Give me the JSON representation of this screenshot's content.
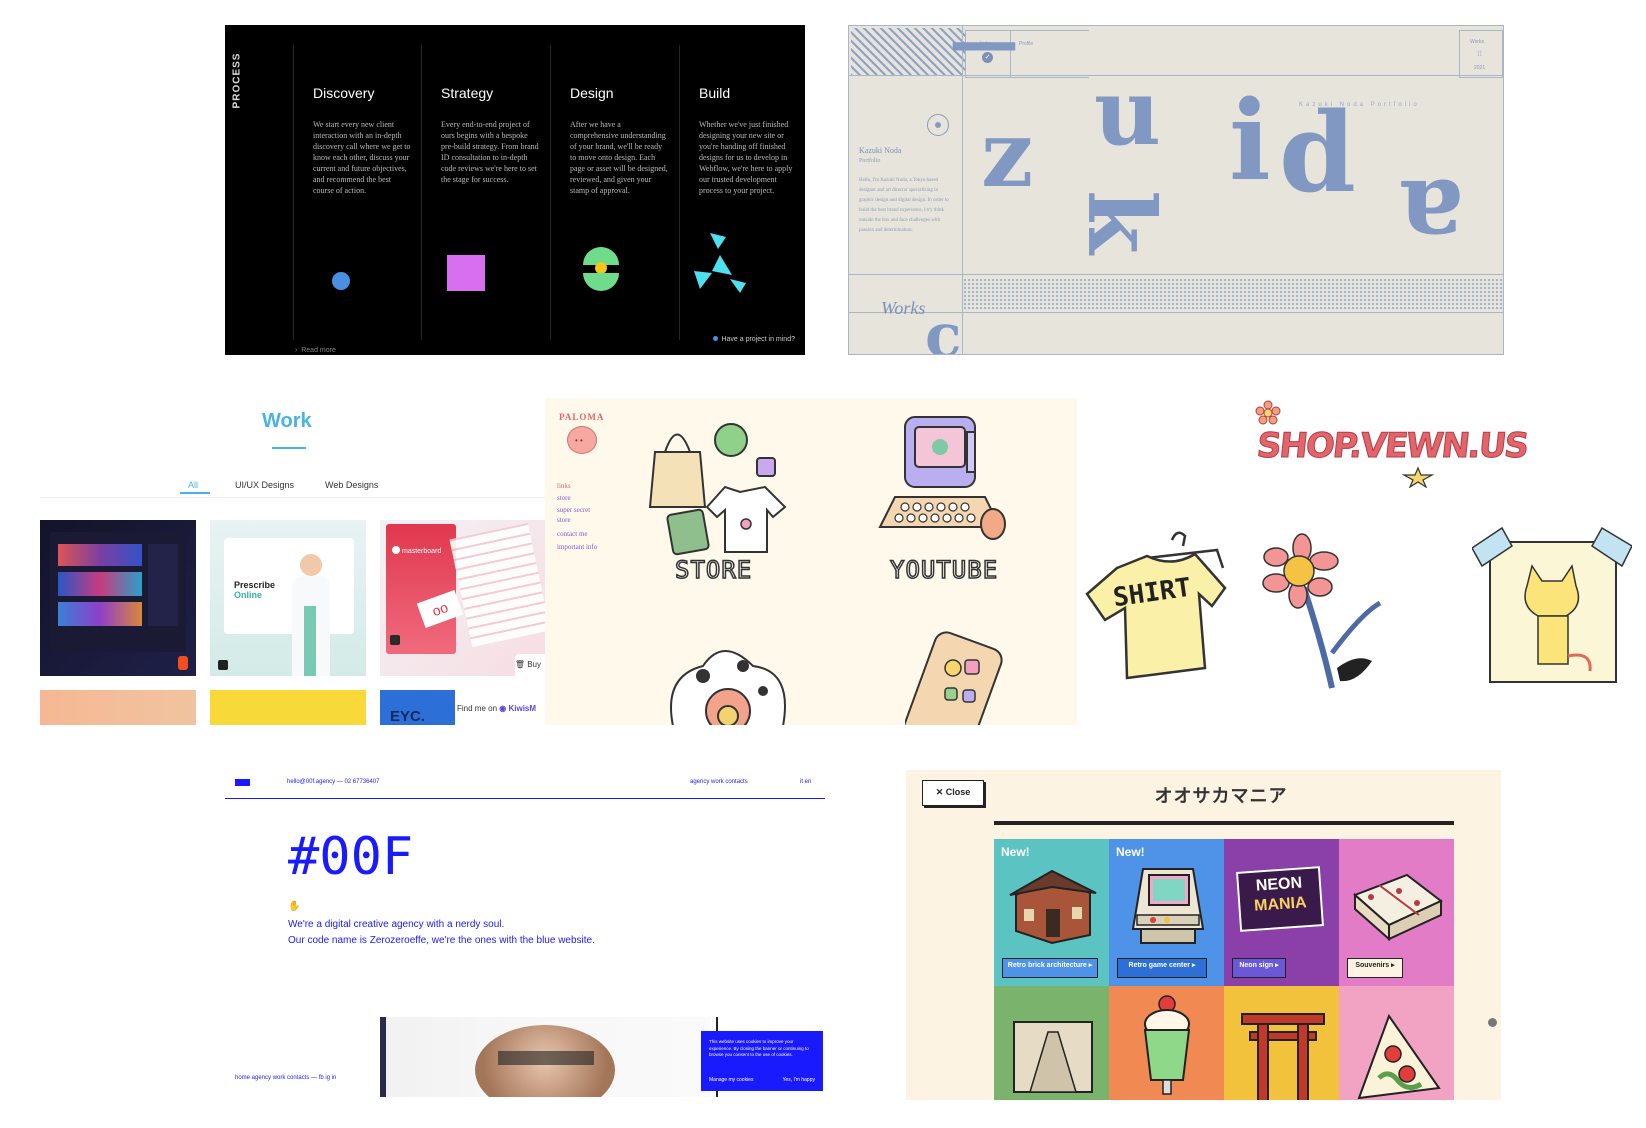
{
  "process": {
    "side_label": "PROCESS",
    "steps": [
      {
        "title": "Discovery",
        "text": "We start every new client interaction with an in-depth discovery call where we get to know each other, discuss your current and future objectives, and recommend the best course of action."
      },
      {
        "title": "Strategy",
        "text": "Every end-to-end project of ours begins with a bespoke pre-build strategy. From brand ID consultation to in-depth code reviews we're here to set the stage for success."
      },
      {
        "title": "Design",
        "text": "After we have a comprehensive understanding of your brand, we'll be ready to move onto design. Each page or asset will be designed, reviewed, and given your stamp of approval."
      },
      {
        "title": "Build",
        "text": "Whether we've just finished designing your new site or you're handing off finished designs for us to develop in Webflow, we're here to apply our trusted development process to your project."
      }
    ],
    "read_more": "Read more",
    "cta": "Have a project in mind?",
    "colors": {
      "circle": "#4a90e2",
      "square": "#d86ff0",
      "green": "#6fdc8c",
      "yellow": "#f5c518",
      "cyan": "#4fe0f0"
    }
  },
  "kazuki": {
    "nav_left": "Index",
    "nav_right": "Profile",
    "corner_top": "Works",
    "corner_bottom": "2021",
    "letters": {
      "z": "z",
      "u": "u",
      "k": "k",
      "i": "i",
      "d": "d",
      "a": "a"
    },
    "tagline": "Kazuki Noda Portfolio",
    "name": "Kazuki Noda",
    "subtitle": "Portfolio",
    "bio": "Hello, I'm Kazuki Noda, a Tokyo based designer and art director specializing in graphic design and digital design. In order to build the best brand experience, I try think outside the box and face challenges with passion and determination.",
    "works": "Works"
  },
  "work": {
    "title": "Work",
    "tabs": [
      "All",
      "UI/UX Designs",
      "Web Designs"
    ],
    "tile_prescribe": "Prescribe",
    "tile_online": "Online",
    "tile_masterboard": "masterboard",
    "tile_eyc": "EYC.",
    "buy": "Buy",
    "find_me": "Find me on",
    "kiwis": "KiwisM"
  },
  "paloma": {
    "logo": "PALOMA",
    "links": [
      "links",
      "store",
      "super secret",
      "store",
      "contact me",
      "important info"
    ],
    "store_label": "STORE",
    "youtube_label": "YOUTUBE"
  },
  "vewn": {
    "logo": "SHOP.VEWN.US",
    "shirt_text": "SHIRT"
  },
  "zerof": {
    "contact": "hello@00f.agency  —  02 67736407",
    "nav": "agency   work   contacts",
    "lang": "it   en",
    "title": "#00F",
    "line1": "We're a digital creative agency with a nerdy soul.",
    "line2": "Our code name is Zerozeroeffe, we're the ones with the blue website.",
    "footer_nav": "home   agency   work   contacts   —   fb   ig   in",
    "cookie_text": "This website uses cookies to improve your experience. By closing the banner or continuing to browse you consent to the use of cookies.",
    "cookie_manage": "Manage my cookies",
    "cookie_accept": "Yes, I'm happy"
  },
  "osaka": {
    "close": "Close",
    "title": "オオサカマニア",
    "new_label": "New!",
    "buttons": [
      "Retro brick architecture",
      "Retro game center",
      "Neon sign",
      "Souvenirs"
    ],
    "neon_line1": "NEON",
    "neon_line2": "MANIA",
    "colors": {
      "teal": "#5bc3c1",
      "blue": "#4f93e8",
      "purple": "#8b3fa8",
      "pink": "#e27cc7",
      "green": "#7ab36b",
      "orange": "#f08a52",
      "yellow": "#f3c23d",
      "rose": "#f2a3c3"
    }
  }
}
